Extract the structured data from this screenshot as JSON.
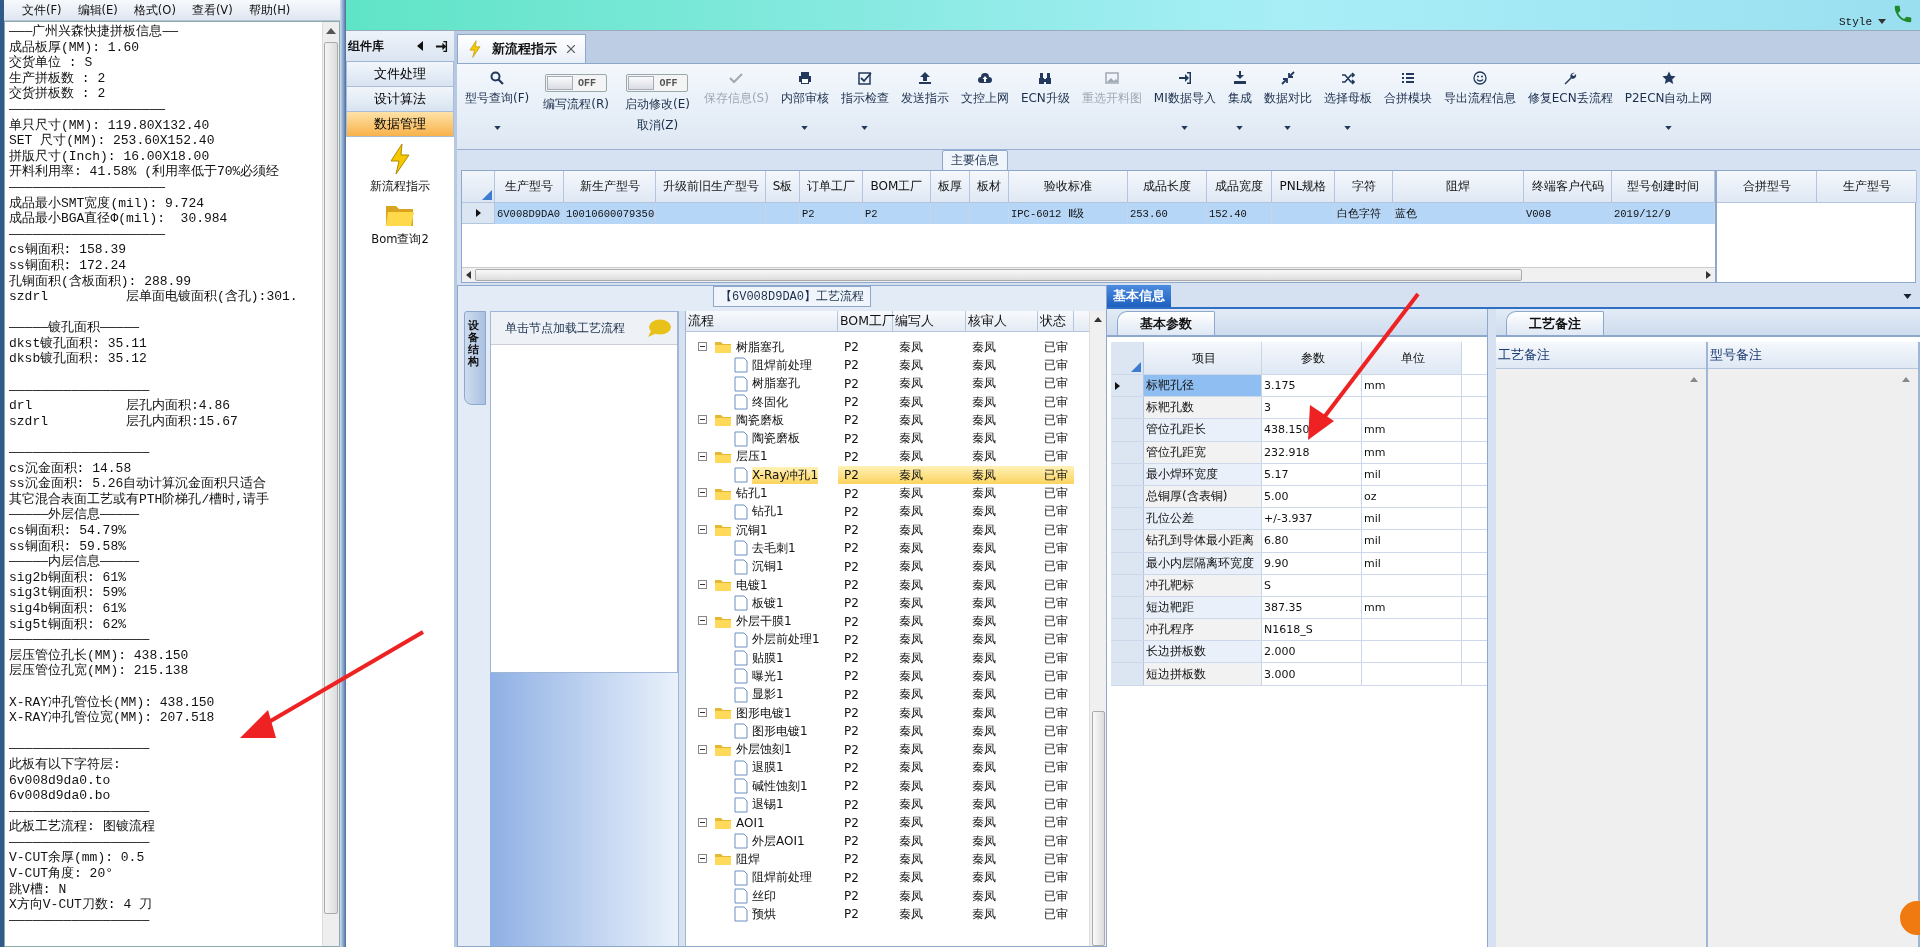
{
  "notepad": {
    "menu": [
      "文件(F)",
      "编辑(E)",
      "格式(O)",
      "查看(V)",
      "帮助(H)"
    ],
    "lines": [
      {
        "kind": "text",
        "text": "———广州兴森快捷拼板信息——"
      },
      {
        "kind": "text",
        "text": "成品板厚(MM): 1.60"
      },
      {
        "kind": "text",
        "text": "交货单位 : S"
      },
      {
        "kind": "text",
        "text": "生产拼板数 : 2"
      },
      {
        "kind": "text",
        "text": "交货拼板数 : 2"
      },
      {
        "kind": "text",
        "text": "————————————————————"
      },
      {
        "kind": "text",
        "text": "单只尺寸(MM): 119.80X132.40"
      },
      {
        "kind": "text",
        "text": "SET 尺寸(MM): 253.60X152.40"
      },
      {
        "kind": "text",
        "text": "拼版尺寸(Inch): 16.00X18.00"
      },
      {
        "kind": "text",
        "text": "开料利用率: 41.58% (利用率低于70%必须经"
      },
      {
        "kind": "text",
        "text": "————————————————————"
      },
      {
        "kind": "text",
        "text": "成品最小SMT宽度(mil): 9.724"
      },
      {
        "kind": "text",
        "text": "成品最小BGA直径Φ(mil):  30.984"
      },
      {
        "kind": "text",
        "text": "————————————————————"
      },
      {
        "kind": "text",
        "text": "cs铜面积: 158.39"
      },
      {
        "kind": "text",
        "text": "ss铜面积: 172.24"
      },
      {
        "kind": "text",
        "text": "孔铜面积(含板面积): 288.99"
      },
      {
        "kind": "text",
        "text": "szdrl          层单面电镀面积(含孔):301."
      },
      {
        "kind": "blank"
      },
      {
        "kind": "text",
        "text": "—————镀孔面积—————"
      },
      {
        "kind": "text",
        "text": "dkst镀孔面积: 35.11"
      },
      {
        "kind": "text",
        "text": "dksb镀孔面积: 35.12"
      },
      {
        "kind": "blank"
      },
      {
        "kind": "text",
        "text": "——————————————————"
      },
      {
        "kind": "text",
        "text": "drl            层孔内面积:4.86"
      },
      {
        "kind": "text",
        "text": "szdrl          层孔内面积:15.67"
      },
      {
        "kind": "blank"
      },
      {
        "kind": "text",
        "text": "——————————————————"
      },
      {
        "kind": "text",
        "text": "cs沉金面积: 14.58"
      },
      {
        "kind": "text",
        "text": "ss沉金面积: 5.26自动计算沉金面积只适合"
      },
      {
        "kind": "text",
        "text": "其它混合表面工艺或有PTH阶梯孔/槽时,请手"
      },
      {
        "kind": "text",
        "text": "—————外层信息—————"
      },
      {
        "kind": "text",
        "text": "cs铜面积: 54.79%"
      },
      {
        "kind": "text",
        "text": "ss铜面积: 59.58%"
      },
      {
        "kind": "text",
        "text": "—————内层信息—————"
      },
      {
        "kind": "text",
        "text": "sig2b铜面积: 61%"
      },
      {
        "kind": "text",
        "text": "sig3t铜面积: 59%"
      },
      {
        "kind": "text",
        "text": "sig4b铜面积: 61%"
      },
      {
        "kind": "text",
        "text": "sig5t铜面积: 62%"
      },
      {
        "kind": "text",
        "text": "——————————————————"
      },
      {
        "kind": "text",
        "text": "层压管位孔长(MM): 438.150"
      },
      {
        "kind": "text",
        "text": "层压管位孔宽(MM): 215.138"
      },
      {
        "kind": "blank"
      },
      {
        "kind": "text",
        "text": "X-RAY冲孔管位长(MM): 438.150"
      },
      {
        "kind": "text",
        "text": "X-RAY冲孔管位宽(MM): 207.518"
      },
      {
        "kind": "blank"
      },
      {
        "kind": "text",
        "text": "——————————————————"
      },
      {
        "kind": "text",
        "text": "此板有以下字符层:"
      },
      {
        "kind": "text",
        "text": "6v008d9da0.to"
      },
      {
        "kind": "text",
        "text": "6v008d9da0.bo"
      },
      {
        "kind": "text",
        "text": "——————————————————"
      },
      {
        "kind": "text",
        "text": "此板工艺流程: 图镀流程"
      },
      {
        "kind": "text",
        "text": "——————————————————"
      },
      {
        "kind": "text",
        "text": "V-CUT余厚(mm): 0.5"
      },
      {
        "kind": "text",
        "text": "V-CUT角度: 20°"
      },
      {
        "kind": "text",
        "text": "跳V槽: N"
      },
      {
        "kind": "text",
        "text": "X方向V-CUT刀数: 4 刀"
      },
      {
        "kind": "text",
        "text": "——————————————————"
      }
    ]
  },
  "topbar": {
    "style_label": "Style"
  },
  "nav": {
    "title": "组件库",
    "items": [
      {
        "label": "文件处理",
        "selected": false
      },
      {
        "label": "设计算法",
        "selected": false
      },
      {
        "label": "数据管理",
        "selected": true
      }
    ],
    "shortcuts": [
      {
        "label": "新流程指示"
      },
      {
        "label": "Bom查询2"
      }
    ]
  },
  "tabs": [
    {
      "label": "新流程指示",
      "selected": true
    }
  ],
  "toolbar": [
    {
      "kind": "button",
      "label": "型号查询(F)",
      "menu": true,
      "disabled": false
    },
    {
      "kind": "toggle",
      "label": "编写流程(R)",
      "state": "OFF",
      "on": false
    },
    {
      "kind": "toggle",
      "label": "启动修改(E)",
      "sublabel": "取消(Z)",
      "state": "OFF",
      "on": false
    },
    {
      "kind": "button",
      "label": "保存信息(S)",
      "menu": false,
      "disabled": true
    },
    {
      "kind": "button",
      "label": "内部审核",
      "menu": true,
      "disabled": false
    },
    {
      "kind": "button",
      "label": "指示检查",
      "menu": true,
      "disabled": false
    },
    {
      "kind": "button",
      "label": "发送指示",
      "menu": false,
      "disabled": false
    },
    {
      "kind": "button",
      "label": "文控上网",
      "menu": false,
      "disabled": false
    },
    {
      "kind": "button",
      "label": "ECN升级",
      "menu": false,
      "disabled": false
    },
    {
      "kind": "button",
      "label": "重选开料图",
      "menu": false,
      "disabled": true
    },
    {
      "kind": "button",
      "label": "MI数据导入",
      "menu": true,
      "disabled": false
    },
    {
      "kind": "button",
      "label": "集成",
      "menu": true,
      "disabled": false
    },
    {
      "kind": "button",
      "label": "数据对比",
      "menu": true,
      "disabled": false
    },
    {
      "kind": "button",
      "label": "选择母板",
      "menu": true,
      "disabled": false
    },
    {
      "kind": "button",
      "label": "合拼模块",
      "menu": false,
      "disabled": false
    },
    {
      "kind": "button",
      "label": "导出流程信息",
      "menu": false,
      "disabled": false
    },
    {
      "kind": "button",
      "label": "修复ECN丢流程",
      "menu": false,
      "disabled": false
    },
    {
      "kind": "button",
      "label": "P2ECN自动上网",
      "menu": true,
      "disabled": false
    }
  ],
  "main_info": {
    "title": "主要信息",
    "columns": [
      "生产型号",
      "新生产型号",
      "升级前旧生产型号",
      "S板",
      "订单工厂",
      "BOM工厂",
      "板厚",
      "板材",
      "验收标准",
      "成品长度",
      "成品宽度",
      "PNL规格",
      "字符",
      "阻焊",
      "终端客户代码",
      "型号创建时间"
    ],
    "rows": [
      {
        "selected": true,
        "cells": [
          "6V008D9DA0",
          "10010600079350",
          null,
          null,
          "P2",
          "P2",
          null,
          null,
          "IPC-6012 Ⅱ级",
          "253.60",
          "152.40",
          null,
          "白色字符",
          "蓝色",
          "V008",
          "2019/12/9"
        ]
      }
    ],
    "merge_columns": [
      "合拼型号",
      "生产型号"
    ]
  },
  "flow": {
    "title": "【6V008D9DA0】工艺流程",
    "side_tab": "设备结构",
    "hint": "单击节点加载工艺流程",
    "columns": [
      "流程",
      "BOM工厂",
      "编写人",
      "核审人",
      "状态"
    ],
    "tree": [
      {
        "name": "树脂塞孔",
        "bom": "P2",
        "writer": "秦凤",
        "reviewer": "秦凤",
        "status": "已审",
        "expanded": true,
        "selected": false,
        "children": [
          {
            "name": "阻焊前处理",
            "bom": "P2",
            "writer": "秦凤",
            "reviewer": "秦凤",
            "status": "已审",
            "selected": false
          },
          {
            "name": "树脂塞孔",
            "bom": "P2",
            "writer": "秦凤",
            "reviewer": "秦凤",
            "status": "已审",
            "selected": false
          },
          {
            "name": "终固化",
            "bom": "P2",
            "writer": "秦凤",
            "reviewer": "秦凤",
            "status": "已审",
            "selected": false
          }
        ]
      },
      {
        "name": "陶瓷磨板",
        "bom": "P2",
        "writer": "秦凤",
        "reviewer": "秦凤",
        "status": "已审",
        "expanded": true,
        "selected": false,
        "children": [
          {
            "name": "陶瓷磨板",
            "bom": "P2",
            "writer": "秦凤",
            "reviewer": "秦凤",
            "status": "已审",
            "selected": false
          }
        ]
      },
      {
        "name": "层压1",
        "bom": "P2",
        "writer": "秦凤",
        "reviewer": "秦凤",
        "status": "已审",
        "expanded": true,
        "selected": false,
        "children": [
          {
            "name": "X-Ray冲孔1",
            "bom": "P2",
            "writer": "秦凤",
            "reviewer": "秦凤",
            "status": "已审",
            "selected": true
          }
        ]
      },
      {
        "name": "钻孔1",
        "bom": "P2",
        "writer": "秦凤",
        "reviewer": "秦凤",
        "status": "已审",
        "expanded": true,
        "selected": false,
        "children": [
          {
            "name": "钻孔1",
            "bom": "P2",
            "writer": "秦凤",
            "reviewer": "秦凤",
            "status": "已审",
            "selected": false
          }
        ]
      },
      {
        "name": "沉铜1",
        "bom": "P2",
        "writer": "秦凤",
        "reviewer": "秦凤",
        "status": "已审",
        "expanded": true,
        "selected": false,
        "children": [
          {
            "name": "去毛刺1",
            "bom": "P2",
            "writer": "秦凤",
            "reviewer": "秦凤",
            "status": "已审",
            "selected": false
          },
          {
            "name": "沉铜1",
            "bom": "P2",
            "writer": "秦凤",
            "reviewer": "秦凤",
            "status": "已审",
            "selected": false
          }
        ]
      },
      {
        "name": "电镀1",
        "bom": "P2",
        "writer": "秦凤",
        "reviewer": "秦凤",
        "status": "已审",
        "expanded": true,
        "selected": false,
        "children": [
          {
            "name": "板镀1",
            "bom": "P2",
            "writer": "秦凤",
            "reviewer": "秦凤",
            "status": "已审",
            "selected": false
          }
        ]
      },
      {
        "name": "外层干膜1",
        "bom": "P2",
        "writer": "秦凤",
        "reviewer": "秦凤",
        "status": "已审",
        "expanded": true,
        "selected": false,
        "children": [
          {
            "name": "外层前处理1",
            "bom": "P2",
            "writer": "秦凤",
            "reviewer": "秦凤",
            "status": "已审",
            "selected": false
          },
          {
            "name": "贴膜1",
            "bom": "P2",
            "writer": "秦凤",
            "reviewer": "秦凤",
            "status": "已审",
            "selected": false
          },
          {
            "name": "曝光1",
            "bom": "P2",
            "writer": "秦凤",
            "reviewer": "秦凤",
            "status": "已审",
            "selected": false
          },
          {
            "name": "显影1",
            "bom": "P2",
            "writer": "秦凤",
            "reviewer": "秦凤",
            "status": "已审",
            "selected": false
          }
        ]
      },
      {
        "name": "图形电镀1",
        "bom": "P2",
        "writer": "秦凤",
        "reviewer": "秦凤",
        "status": "已审",
        "expanded": true,
        "selected": false,
        "children": [
          {
            "name": "图形电镀1",
            "bom": "P2",
            "writer": "秦凤",
            "reviewer": "秦凤",
            "status": "已审",
            "selected": false
          }
        ]
      },
      {
        "name": "外层蚀刻1",
        "bom": "P2",
        "writer": "秦凤",
        "reviewer": "秦凤",
        "status": "已审",
        "expanded": true,
        "selected": false,
        "children": [
          {
            "name": "退膜1",
            "bom": "P2",
            "writer": "秦凤",
            "reviewer": "秦凤",
            "status": "已审",
            "selected": false
          },
          {
            "name": "碱性蚀刻1",
            "bom": "P2",
            "writer": "秦凤",
            "reviewer": "秦凤",
            "status": "已审",
            "selected": false
          },
          {
            "name": "退锡1",
            "bom": "P2",
            "writer": "秦凤",
            "reviewer": "秦凤",
            "status": "已审",
            "selected": false
          }
        ]
      },
      {
        "name": "AOI1",
        "bom": "P2",
        "writer": "秦凤",
        "reviewer": "秦凤",
        "status": "已审",
        "expanded": true,
        "selected": false,
        "children": [
          {
            "name": "外层AOI1",
            "bom": "P2",
            "writer": "秦凤",
            "reviewer": "秦凤",
            "status": "已审",
            "selected": false
          }
        ]
      },
      {
        "name": "阻焊",
        "bom": "P2",
        "writer": "秦凤",
        "reviewer": "秦凤",
        "status": "已审",
        "expanded": true,
        "selected": false,
        "children": [
          {
            "name": "阻焊前处理",
            "bom": "P2",
            "writer": "秦凤",
            "reviewer": "秦凤",
            "status": "已审",
            "selected": false
          },
          {
            "name": "丝印",
            "bom": "P2",
            "writer": "秦凤",
            "reviewer": "秦凤",
            "status": "已审",
            "selected": false
          },
          {
            "name": "预烘",
            "bom": "P2",
            "writer": "秦凤",
            "reviewer": "秦凤",
            "status": "已审",
            "selected": false
          }
        ]
      }
    ]
  },
  "basic": {
    "tab": "基本信息",
    "subtab": "基本参数",
    "columns": [
      "项目",
      "参数",
      "单位"
    ],
    "rows": [
      {
        "item": "标靶孔径",
        "value": "3.175",
        "unit": "mm",
        "selected": true
      },
      {
        "item": "标靶孔数",
        "value": "3",
        "selected": false
      },
      {
        "item": "管位孔距长",
        "value": "438.150",
        "unit": "mm",
        "selected": false
      },
      {
        "item": "管位孔距宽",
        "value": "232.918",
        "unit": "mm",
        "selected": false
      },
      {
        "item": "最小焊环宽度",
        "value": "5.17",
        "unit": "mil",
        "selected": false
      },
      {
        "item": "总铜厚(含表铜)",
        "value": "5.00",
        "unit": "oz",
        "selected": false
      },
      {
        "item": "孔位公差",
        "value": "+/-3.937",
        "unit": "mil",
        "selected": false
      },
      {
        "item": "钻孔到导体最小距离",
        "value": "6.80",
        "unit": "mil",
        "selected": false
      },
      {
        "item": "最小内层隔离环宽度",
        "value": "9.90",
        "unit": "mil",
        "selected": false
      },
      {
        "item": "冲孔靶标",
        "value": "S",
        "selected": false
      },
      {
        "item": "短边靶距",
        "value": "387.35",
        "unit": "mm",
        "selected": false
      },
      {
        "item": "冲孔程序",
        "value": "N1618_S",
        "selected": false
      },
      {
        "item": "长边拼板数",
        "value": "2.000",
        "selected": false
      },
      {
        "item": "短边拼板数",
        "value": "3.000",
        "selected": false
      }
    ]
  },
  "notes": {
    "tab": "工艺备注",
    "columns": [
      "工艺备注",
      "型号备注"
    ]
  }
}
